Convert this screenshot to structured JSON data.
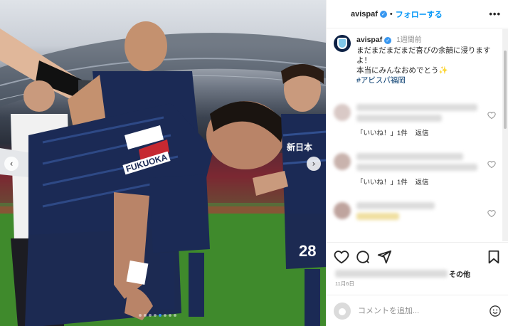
{
  "post": {
    "username": "avispaf",
    "follow_label": "フォローする",
    "separator": "•",
    "more_label": "•••"
  },
  "caption": {
    "username": "avispaf",
    "time": "1週間前",
    "lines": [
      "まだまだまだまだ喜びの余韻に浸りますよ！",
      "本当にみんなおめでとう✨"
    ],
    "hashtag": "#アビスパ福岡"
  },
  "comments": [
    {
      "like_label": "「いいね！」1件",
      "reply_label": "返信"
    },
    {
      "like_label": "「いいね！」1件",
      "reply_label": "返信"
    },
    {
      "like_label": "",
      "reply_label": ""
    }
  ],
  "likes": {
    "suffix": "その他"
  },
  "date": "11月6日",
  "add_comment": {
    "placeholder": "コメントを追加..."
  },
  "photo": {
    "sponsor_text": "FUKUOKA",
    "jersey_text": "新日本",
    "number": "28"
  },
  "icons": {
    "nav_left": "‹",
    "nav_right": "›",
    "verified": "✓"
  },
  "colors": {
    "accent": "#0095f6",
    "verified": "#3897f0",
    "kit_navy": "#1b2a55"
  }
}
